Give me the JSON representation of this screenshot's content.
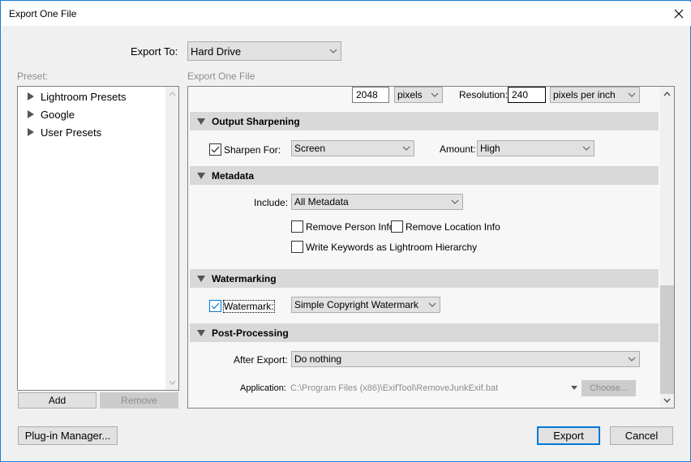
{
  "window": {
    "title": "Export One File"
  },
  "export_to": {
    "label": "Export To:",
    "value": "Hard Drive"
  },
  "preset_panel": {
    "label": "Preset:",
    "items": [
      {
        "label": "Lightroom Presets"
      },
      {
        "label": "Google"
      },
      {
        "label": "User Presets"
      }
    ],
    "add_label": "Add",
    "remove_label": "Remove"
  },
  "settings_panel": {
    "label": "Export One File",
    "image_sizing": {
      "size_value": "2048",
      "size_unit": "pixels",
      "resolution_label": "Resolution:",
      "resolution_value": "240",
      "resolution_unit": "pixels per inch"
    },
    "output_sharpening": {
      "title": "Output Sharpening",
      "sharpen_for_label": "Sharpen For:",
      "sharpen_for_checked": true,
      "sharpen_for_value": "Screen",
      "amount_label": "Amount:",
      "amount_value": "High"
    },
    "metadata": {
      "title": "Metadata",
      "include_label": "Include:",
      "include_value": "All Metadata",
      "remove_person_label": "Remove Person Info",
      "remove_person_checked": false,
      "remove_location_label": "Remove Location Info",
      "remove_location_checked": false,
      "write_keywords_label": "Write Keywords as Lightroom Hierarchy",
      "write_keywords_checked": false
    },
    "watermarking": {
      "title": "Watermarking",
      "watermark_label": "Watermark:",
      "watermark_checked": true,
      "watermark_value": "Simple Copyright Watermark"
    },
    "post_processing": {
      "title": "Post-Processing",
      "after_export_label": "After Export:",
      "after_export_value": "Do nothing",
      "application_label": "Application:",
      "application_value": "C:\\Program Files (x86)\\ExifTool\\RemoveJunkExif.bat",
      "choose_label": "Choose..."
    }
  },
  "footer": {
    "plugin_manager_label": "Plug-in Manager...",
    "export_label": "Export",
    "cancel_label": "Cancel"
  },
  "colors": {
    "accent": "#0078d7",
    "window_border": "#1a7fd4"
  }
}
